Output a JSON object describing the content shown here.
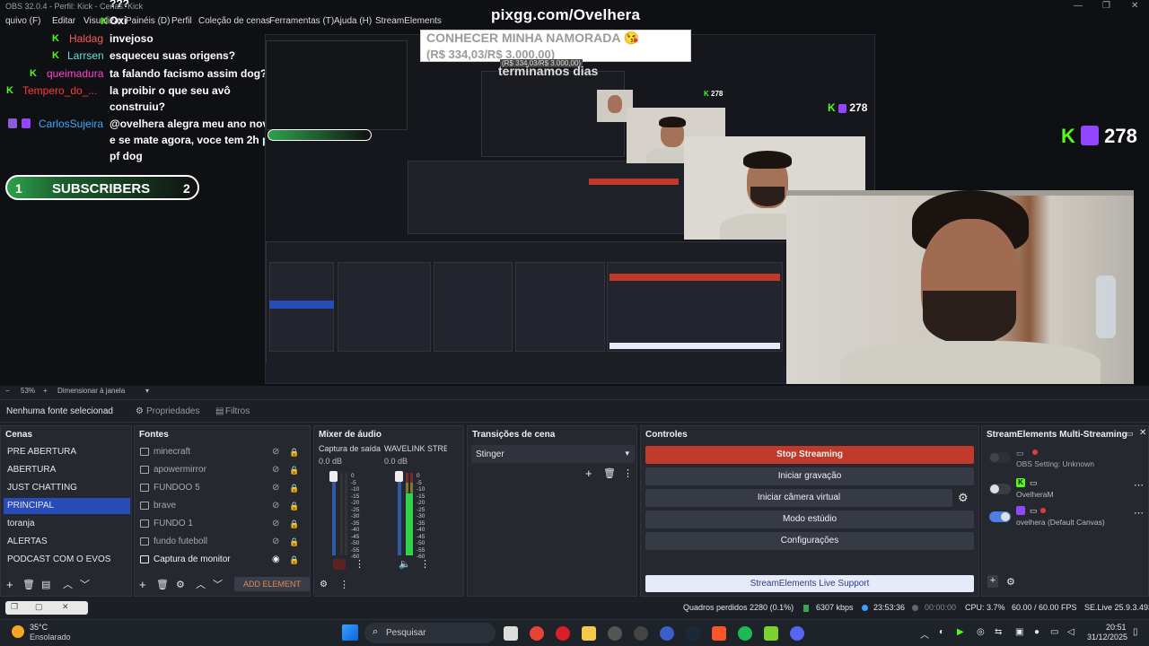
{
  "window": {
    "title": "OBS 32.0.4 - Perfil: Kick - Cenas: Kick"
  },
  "menu": [
    "quivo (F)",
    "Editar",
    "Visualizar",
    "Painéis (D)",
    "Perfil",
    "Coleção de cenas",
    "Ferramentas (T)",
    "Ajuda (H)",
    "StreamElements"
  ],
  "preview": {
    "url_title": "pixgg.com/Ovelhera",
    "banner_line1": "CONHECER MINHA NAMORADA 😘",
    "banner_line2": "(R$ 334,03/R$ 3.000,00)",
    "banner_sub": "(R$ 334,03/R$ 3.000,00)",
    "ghost_text": "terminamos dias",
    "viewers_large": "278",
    "viewers_mid": "278",
    "viewers_small": "278",
    "chat": [
      {
        "user": "Tempero_do_",
        "message": "???",
        "platform": "kick"
      },
      {
        "user": "",
        "message": "Oxi",
        "platform": "kick"
      },
      {
        "user": "Haldag",
        "message": "invejoso",
        "platform": "kick"
      },
      {
        "user": "Larrsen",
        "message": "esqueceu suas origens?",
        "platform": "kick"
      },
      {
        "user": "queimadura",
        "message": "ta falando facismo assim dog?",
        "platform": "kick"
      },
      {
        "user": "Tempero_do_...",
        "message": "la proibir o que seu avô",
        "platform": "kick"
      },
      {
        "user": "",
        "message": "construiu?",
        "platform": "kick"
      },
      {
        "user": "CarlosSujeira",
        "message": "@ovelhera alegra meu ano novo",
        "platform": "twitch"
      },
      {
        "user": "",
        "message": "e se mate agora, voce tem 2h pf",
        "platform": "twitch"
      },
      {
        "user": "",
        "message": "pf dog",
        "platform": "twitch"
      }
    ],
    "subs": {
      "left": "1",
      "label": "SUBSCRIBERS",
      "right": "2"
    }
  },
  "zoombar": {
    "minus": "−",
    "zoom": "53%",
    "plus": "+",
    "mode": "Dimensionar à janela"
  },
  "sourcebar": {
    "none_selected": "Nenhuma fonte selecionad",
    "properties": "Propriedades",
    "filters": "Filtros"
  },
  "scenes": {
    "title": "Cenas",
    "items": [
      "PRE ABERTURA",
      "ABERTURA",
      "JUST CHATTING",
      "PRINCIPAL",
      "toranja",
      "ALERTAS",
      "PODCAST COM O EVOS"
    ],
    "active_index": 3
  },
  "sources": {
    "title": "Fontes",
    "items": [
      "minecraft",
      "apowermirror",
      "FUNDOO 5",
      "brave",
      "FUNDO 1",
      "fundo futeboll",
      "Captura de monitor"
    ],
    "add_element": "ADD ELEMENT"
  },
  "mixer": {
    "title": "Mixer de áudio",
    "channels": [
      {
        "name": "Captura de saída d",
        "db": "0.0 dB"
      },
      {
        "name": "WAVELINK STREAM",
        "db": "0.0 dB"
      }
    ],
    "scale": [
      "0",
      "-5",
      "-10",
      "-15",
      "-20",
      "-25",
      "-30",
      "-35",
      "-40",
      "-45",
      "-50",
      "-55",
      "-60"
    ]
  },
  "transitions": {
    "title": "Transições de cena",
    "selected": "Stinger"
  },
  "controls": {
    "title": "Controles",
    "stop_streaming": "Stop Streaming",
    "start_recording": "Iniciar gravação",
    "virtual_camera": "Iniciar câmera virtual",
    "studio_mode": "Modo estúdio",
    "settings": "Configurações",
    "support": "StreamElements Live Support"
  },
  "streamelements": {
    "title": "StreamElements Multi-Streaming",
    "rows": [
      {
        "label": "OBS Setting: Unknown",
        "enabled": false
      },
      {
        "label": "OvelheraM",
        "enabled": false
      },
      {
        "label": "ovelhera (Default Canvas)",
        "enabled": true
      }
    ]
  },
  "status": {
    "dropped": "Quadros perdidos 2280 (0.1%)",
    "bitrate": "6307 kbps",
    "stream_time": "23:53:36",
    "rec_time": "00:00:00",
    "cpu": "CPU: 3.7%",
    "fps": "60.00 / 60.00 FPS",
    "version": "SE.Live 25.9.3.493"
  },
  "taskbar": {
    "temp": "35°C",
    "weather": "Ensolarado",
    "search": "Pesquisar",
    "time": "20:51",
    "date": "31/12/2025"
  },
  "colors": {
    "accent": "#284cb8",
    "stop": "#c0392b",
    "kick": "#53fc18",
    "twitch": "#9146ff"
  }
}
